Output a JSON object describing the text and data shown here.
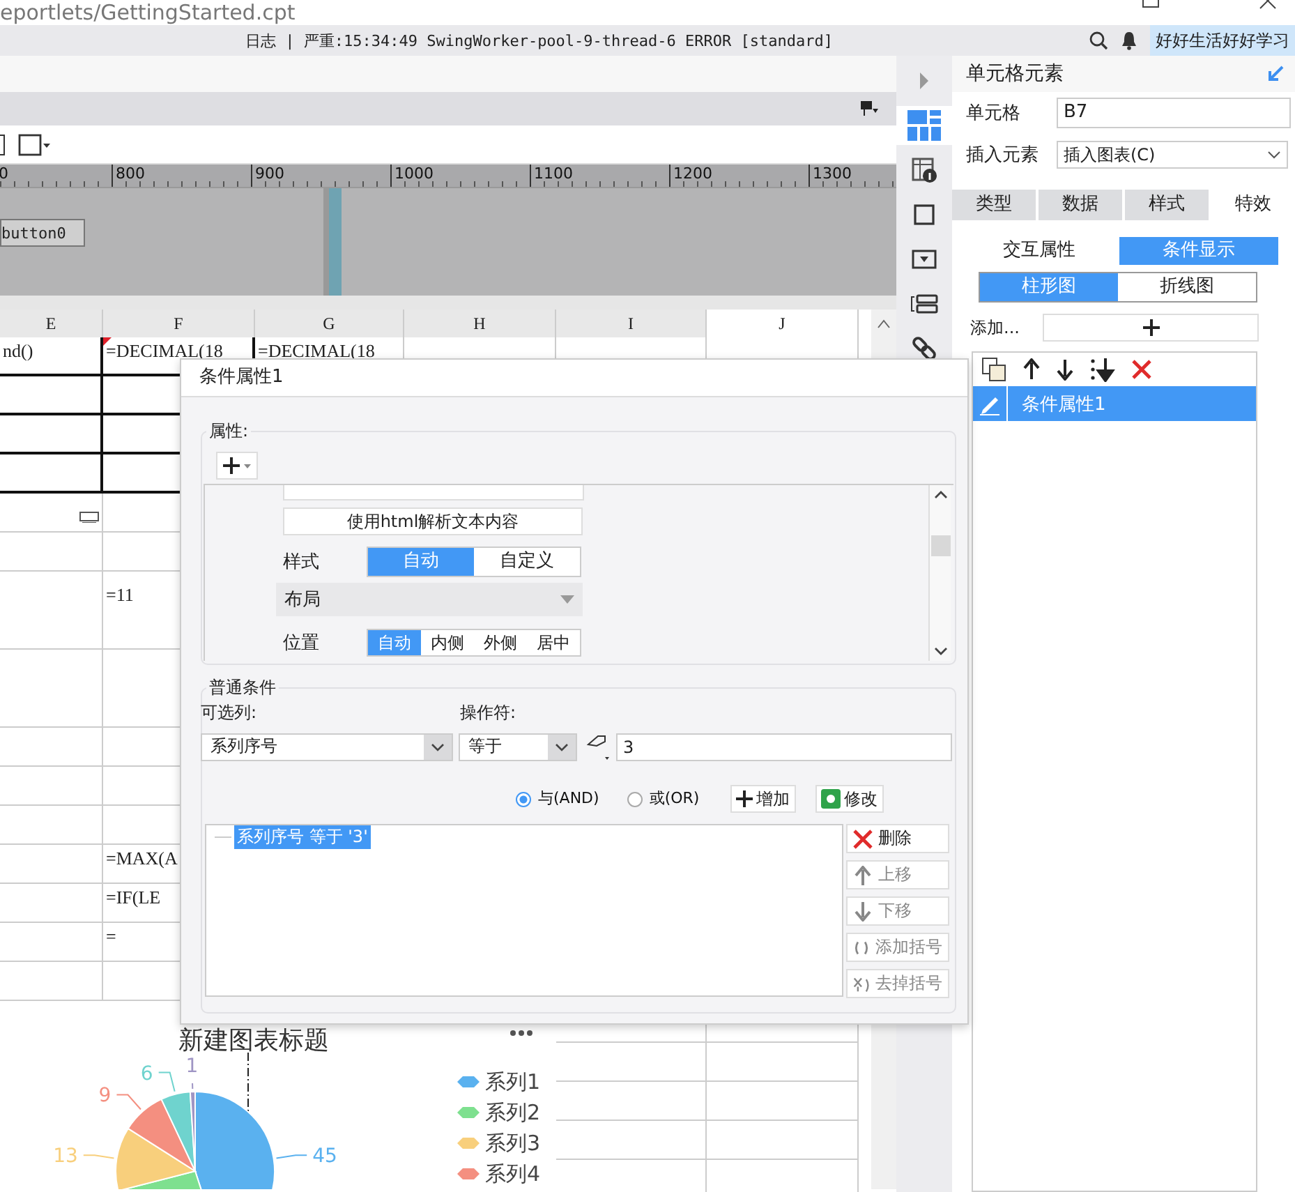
{
  "window": {
    "title": "eportlets/GettingStarted.cpt"
  },
  "log_bar": {
    "text": "日志 | 严重:15:34:49 SwingWorker-pool-9-thread-6 ERROR [standard]",
    "user": "好好生活好好学习"
  },
  "ruler": {
    "ticks": [
      "0",
      "800",
      "900",
      "1000",
      "1100",
      "1200",
      "1300"
    ]
  },
  "canvas": {
    "button": "button0"
  },
  "sheet": {
    "columns": [
      "E",
      "F",
      "G",
      "H",
      "I",
      "J"
    ],
    "rows": [
      {
        "kind": "bordered",
        "marked": true,
        "cells": {
          "E": "nd()",
          "F": "=DECIMAL(18",
          "G": "=DECIMAL(18"
        }
      },
      {
        "kind": "bordered"
      },
      {
        "kind": "bordered"
      },
      {
        "kind": "bordered"
      },
      {
        "kind": "icon"
      },
      {
        "kind": "normal"
      },
      {
        "kind": "tall",
        "cells": {
          "F": "=11"
        }
      },
      {
        "kind": "tall"
      },
      {
        "kind": "normal"
      },
      {
        "kind": "normal"
      },
      {
        "kind": "normal"
      },
      {
        "kind": "normal",
        "cells": {
          "F": "=MAX(A"
        }
      },
      {
        "kind": "normal",
        "cells": {
          "F": "=IF(LE"
        }
      },
      {
        "kind": "normal",
        "cells": {
          "F": "="
        }
      },
      {
        "kind": "normal"
      }
    ]
  },
  "chart": {
    "chart_data": {
      "type": "pie",
      "title": "新建图表标题",
      "values": [
        45,
        26,
        13,
        9,
        6,
        1
      ],
      "value_labels": [
        "45",
        null,
        "13",
        "9",
        "6",
        "1"
      ]
    },
    "legend": [
      "系列1",
      "系列2",
      "系列3",
      "系列4"
    ]
  },
  "side_icons": [
    {
      "kind": "collapse",
      "selected": false
    },
    {
      "kind": "cell",
      "selected": true
    },
    {
      "kind": "cell-info",
      "selected": false
    },
    {
      "kind": "frame",
      "selected": false
    },
    {
      "kind": "dropdown",
      "selected": false
    },
    {
      "kind": "list",
      "selected": false
    },
    {
      "kind": "link",
      "selected": false
    }
  ],
  "right_panel": {
    "title": "单元格元素",
    "cell_label": "单元格",
    "cell_value": "B7",
    "insert_label": "插入元素",
    "insert_value": "插入图表(C)",
    "tabs": [
      {
        "label": "类型",
        "selected": false
      },
      {
        "label": "数据",
        "selected": false
      },
      {
        "label": "样式",
        "selected": false
      },
      {
        "label": "特效",
        "selected": true
      }
    ],
    "subtabs": [
      {
        "label": "交互属性",
        "selected": false
      },
      {
        "label": "条件显示",
        "selected": true
      }
    ],
    "chart_tabs": [
      {
        "label": "柱形图",
        "selected": true
      },
      {
        "label": "折线图",
        "selected": false
      }
    ],
    "add_label": "添加...",
    "conditions": [
      {
        "label": "条件属性1",
        "selected": true
      }
    ]
  },
  "dialog": {
    "title": "条件属性1",
    "properties": {
      "legend": "属性:",
      "html_button": "使用html解析文本内容",
      "style_label": "样式",
      "style_options": [
        {
          "label": "自动",
          "selected": true
        },
        {
          "label": "自定义",
          "selected": false
        }
      ],
      "layout_label": "布局",
      "position_label": "位置",
      "position_options": [
        {
          "label": "自动",
          "selected": true
        },
        {
          "label": "内侧",
          "selected": false
        },
        {
          "label": "外侧",
          "selected": false
        },
        {
          "label": "居中",
          "selected": false
        }
      ]
    },
    "condition": {
      "legend": "普通条件",
      "column_label": "可选列:",
      "column_value": "系列序号",
      "operator_label": "操作符:",
      "operator_value": "等于",
      "value": "3",
      "logic": [
        {
          "label": "与(AND)",
          "selected": true
        },
        {
          "label": "或(OR)",
          "selected": false
        }
      ],
      "add_button": "增加",
      "modify_button": "修改",
      "items": [
        {
          "text": "系列序号 等于 '3'",
          "selected": true
        }
      ],
      "side_buttons": [
        {
          "kind": "delete",
          "label": "删除",
          "disabled": false
        },
        {
          "kind": "up",
          "label": "上移",
          "disabled": true
        },
        {
          "kind": "down",
          "label": "下移",
          "disabled": true
        },
        {
          "kind": "add-bracket",
          "label": "添加括号",
          "disabled": true
        },
        {
          "kind": "remove-bracket",
          "label": "去掉括号",
          "disabled": true
        }
      ]
    }
  }
}
